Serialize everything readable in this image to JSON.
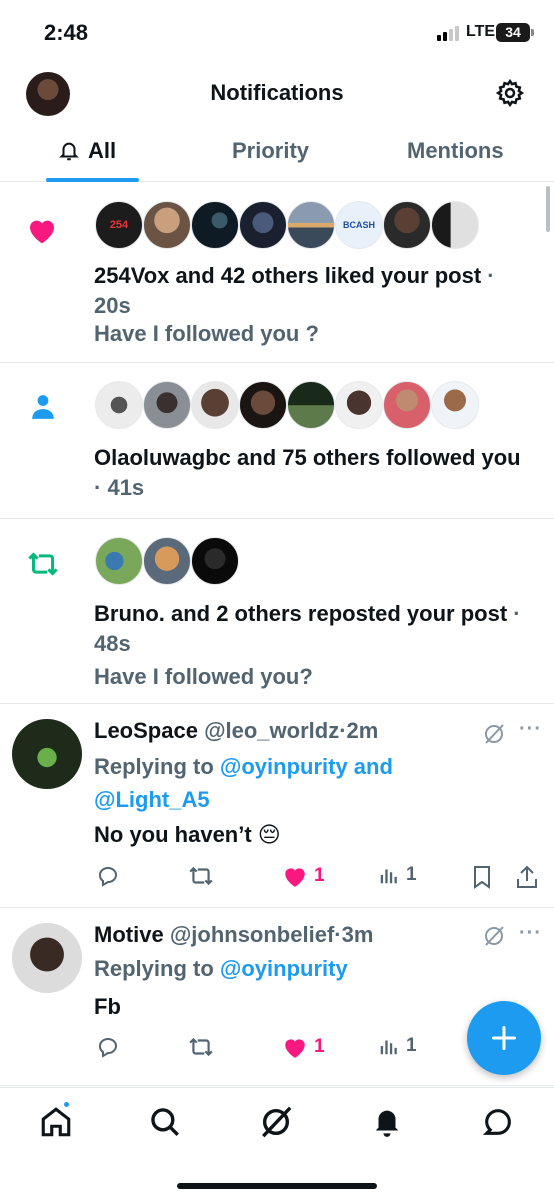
{
  "status_bar": {
    "time": "2:48",
    "network": "LTE",
    "battery": "34"
  },
  "header": {
    "title": "Notifications",
    "avatar_icon": "profile-avatar",
    "settings_icon": "gear-icon"
  },
  "tabs": [
    {
      "label": "All",
      "active": true,
      "icon": "bell-icon"
    },
    {
      "label": "Priority",
      "active": false
    },
    {
      "label": "Mentions",
      "active": false
    }
  ],
  "notifications": [
    {
      "type": "like",
      "icon": "heart-icon",
      "icon_color": "#f91880",
      "avatar_colors": [
        "#1c1c1c",
        "#b08a6a",
        "#0e1a24",
        "#2a3240",
        "#8a9bb0",
        "#e8f0fa",
        "#3a2c26",
        "#c7c7c7"
      ],
      "avatar_texts": [
        "254",
        "",
        "",
        "",
        "",
        "BCASH",
        "",
        ""
      ],
      "text": "254Vox and 42 others liked your post",
      "time": "20s",
      "comment": "Have I followed you ?"
    },
    {
      "type": "follow",
      "icon": "person-icon",
      "icon_color": "#1d9bf0",
      "avatar_colors": [
        "#e8e8e8",
        "#8a8f96",
        "#3b2f2a",
        "#1a1412",
        "#5d7a4a",
        "#2a2220",
        "#d7606a",
        "#f0c8a0"
      ],
      "text": "Olaoluwagbc and 75 others followed you",
      "time": "41s"
    },
    {
      "type": "repost",
      "icon": "repost-icon",
      "icon_color": "#00ba7c",
      "avatar_colors": [
        "#7aa85a",
        "#c58a4a",
        "#111111"
      ],
      "text": "Bruno. and 2 others reposted your post",
      "time": "48s",
      "comment": "Have I followed you?"
    }
  ],
  "tweets": [
    {
      "name": "LeoSpace",
      "handle": "@leo_worldz",
      "time": "2m",
      "replying_prefix": "Replying to",
      "replying_line1": "@oyinpurity and",
      "replying_line2": "@Light_A5",
      "body": "No you haven’t 😔",
      "likes": "1",
      "views": "1",
      "avatar_color": "#1e2a1a"
    },
    {
      "name": "Motive",
      "handle": "@johnsonbelief",
      "time": "3m",
      "replying_prefix": "Replying to",
      "replying_line1": "@oyinpurity",
      "body": "Fb",
      "likes": "1",
      "views": "1",
      "avatar_color": "#3a3a3a"
    }
  ],
  "fab": {
    "icon": "plus-icon"
  },
  "bottom_nav": [
    "home-icon",
    "search-icon",
    "grok-icon",
    "bell-icon",
    "messages-icon"
  ],
  "colors": {
    "accent": "#1d9bf0",
    "like": "#f91880",
    "repost": "#00ba7c",
    "muted": "#536471"
  }
}
